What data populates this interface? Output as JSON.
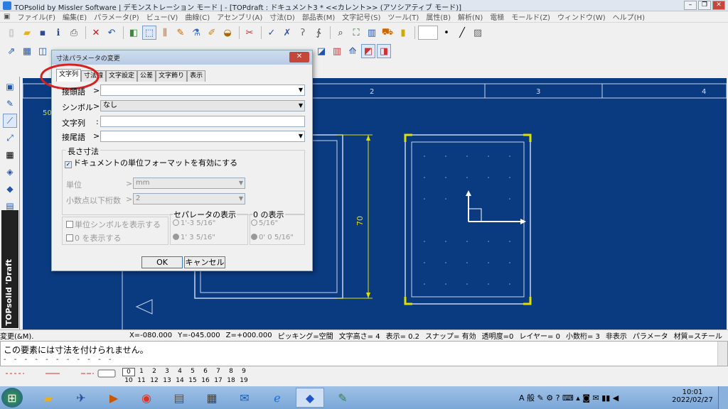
{
  "app": {
    "title": "TOPsolid by Missler Software | デモンストレーション モード | - [TOPdraft : ドキュメント3 *  <<カレント>> (アソシアティブ モード)]"
  },
  "menu": [
    "ファイル(F)",
    "編集(E)",
    "パラメータ(P)",
    "ビュー(V)",
    "曲線(C)",
    "アセンブリ(A)",
    "寸法(D)",
    "部品表(M)",
    "文字記号(S)",
    "ツール(T)",
    "属性(B)",
    "解析(N)",
    "電極",
    "モールド(Z)",
    "ウィンドウ(W)",
    "ヘルプ(H)"
  ],
  "brand": "TOPsolid 'Draft",
  "canvas": {
    "ruler": [
      "2",
      "3",
      "4"
    ],
    "left_mark": "50",
    "dim_label": "70"
  },
  "dialog": {
    "title": "寸法パラメータの変更",
    "tabs": [
      "文字列",
      "寸法線",
      "文字設定",
      "公差",
      "文字飾り",
      "表示"
    ],
    "prefix_label": "接頭語",
    "prefix_value": "",
    "symbol_label": "シンボル",
    "symbol_value": "なし",
    "text_label": "文字列",
    "text_value": "",
    "suffix_label": "接尾語",
    "suffix_value": "",
    "length_group": "長さ寸法",
    "doc_format_label": "ドキュメントの単位フォーマットを有効にする",
    "unit_label": "単位",
    "unit_value": "mm",
    "decimals_label": "小数点以下桁数",
    "decimals_value": "2",
    "show_unit_symbol": "単位シンボルを表示する",
    "show_zero": "0 を表示する",
    "separator_group": "セパレータの表示",
    "sep_opt1": "1'-3 5/16\"",
    "sep_opt2": "1' 3 5/16\"",
    "zero_group": "0 の表示",
    "zero_opt1": "5/16\"",
    "zero_opt2": "0' 0 5/16\"",
    "ok": "OK",
    "cancel": "キャンセル"
  },
  "status": [
    "変更(&M).",
    "X=-080.000",
    "Y=-045.000",
    "Z=+000.000",
    "ピッキング=空間",
    "文字高さ=  4",
    "表示=  0.2",
    "スナップ= 有効",
    "透明度=0",
    "レイヤー=  0",
    "小数桁= 3",
    "非表示",
    "パラメータ",
    "材質=スチール"
  ],
  "message": "この要素には寸法を付けられません。",
  "layers_top": [
    "0",
    "1",
    "2",
    "3",
    "4",
    "5",
    "6",
    "7",
    "8",
    "9"
  ],
  "layers_bottom": [
    "10",
    "11",
    "12",
    "13",
    "14",
    "15",
    "16",
    "17",
    "18",
    "19"
  ],
  "clock": {
    "time": "10:01",
    "date": "2022/02/27"
  },
  "tray": {
    "ime": "A 般"
  },
  "colors": {
    "canvas": "#0a3a80",
    "highlight": "#d82020",
    "dim_line": "#e0e000"
  }
}
